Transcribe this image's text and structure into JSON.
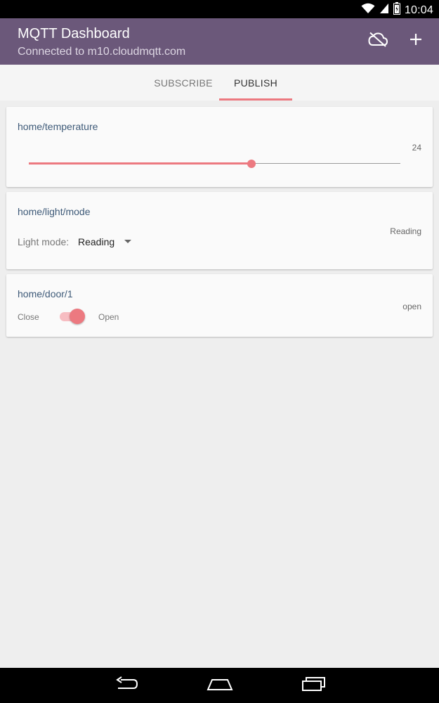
{
  "status_bar": {
    "time": "10:04",
    "icons": [
      "wifi-icon",
      "cell-signal-icon",
      "battery-icon"
    ]
  },
  "app_bar": {
    "title": "MQTT Dashboard",
    "subtitle": "Connected to m10.cloudmqtt.com",
    "actions": [
      "cloud-off-icon",
      "add-icon"
    ],
    "background": "#6b587a"
  },
  "tabs": [
    {
      "label": "SUBSCRIBE",
      "selected": false
    },
    {
      "label": "PUBLISH",
      "selected": true
    }
  ],
  "cards": {
    "temperature": {
      "topic": "home/temperature",
      "value": "24",
      "slider_fraction": 0.6
    },
    "light": {
      "topic": "home/light/mode",
      "value": "Reading",
      "label": "Light mode:",
      "selected": "Reading"
    },
    "door": {
      "topic": "home/door/1",
      "value": "open",
      "off_label": "Close",
      "on_label": "Open",
      "checked": true
    }
  },
  "nav_bar": {
    "icons": [
      "back-icon",
      "home-icon",
      "recents-icon"
    ]
  },
  "colors": {
    "accent": "#ec7980",
    "topic": "#3e5a78",
    "app_bar": "#6b587a"
  }
}
